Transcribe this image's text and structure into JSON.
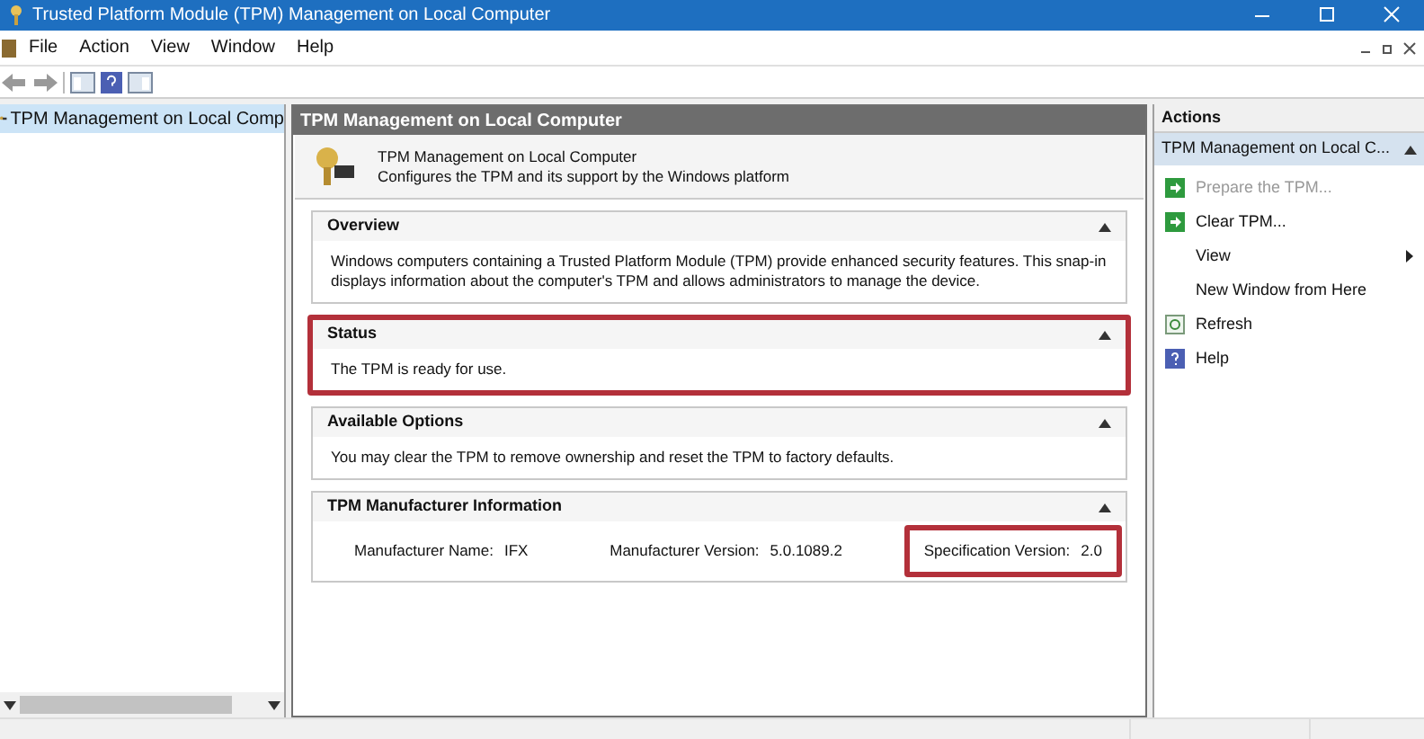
{
  "window": {
    "title": "Trusted Platform Module (TPM) Management on Local Computer"
  },
  "menu": [
    "File",
    "Action",
    "View",
    "Window",
    "Help"
  ],
  "tree": {
    "items": [
      {
        "label": "TPM Management on Local Comp",
        "selected": true
      }
    ]
  },
  "center": {
    "header": "TPM Management on Local Computer",
    "title": "TPM Management on Local Computer",
    "subtitle": "Configures the TPM and its support by the Windows platform",
    "sections": [
      {
        "kind": "text",
        "title": "Overview",
        "highlighted": false,
        "text": "Windows computers containing a Trusted Platform Module (TPM) provide enhanced security features. This snap-in displays information about the computer's TPM and allows administrators to manage the device."
      },
      {
        "kind": "text",
        "title": "Status",
        "highlighted": true,
        "text": "The TPM is ready for use."
      },
      {
        "kind": "text",
        "title": "Available Options",
        "highlighted": false,
        "text": "You may clear the TPM to remove ownership and reset the TPM to factory defaults."
      },
      {
        "kind": "fields",
        "title": "TPM Manufacturer Information",
        "highlighted": false,
        "fields": [
          {
            "label": "Manufacturer Name:",
            "value": "IFX",
            "highlighted": false
          },
          {
            "label": "Manufacturer Version:",
            "value": "5.0.1089.2",
            "highlighted": false
          },
          {
            "label": "Specification Version:",
            "value": "2.0",
            "highlighted": true
          }
        ]
      }
    ]
  },
  "actions": {
    "title": "Actions",
    "group": "TPM Management on Local C...",
    "items": [
      {
        "label": "Prepare the TPM...",
        "kind": "task",
        "disabled": true,
        "submenu": false
      },
      {
        "label": "Clear TPM...",
        "kind": "task",
        "disabled": false,
        "submenu": false
      },
      {
        "label": "View",
        "kind": "plain",
        "disabled": false,
        "submenu": true
      },
      {
        "label": "New Window from Here",
        "kind": "plain",
        "disabled": false,
        "submenu": false
      },
      {
        "label": "Refresh",
        "kind": "refresh",
        "disabled": false,
        "submenu": false
      },
      {
        "label": "Help",
        "kind": "help",
        "disabled": false,
        "submenu": false
      }
    ]
  }
}
